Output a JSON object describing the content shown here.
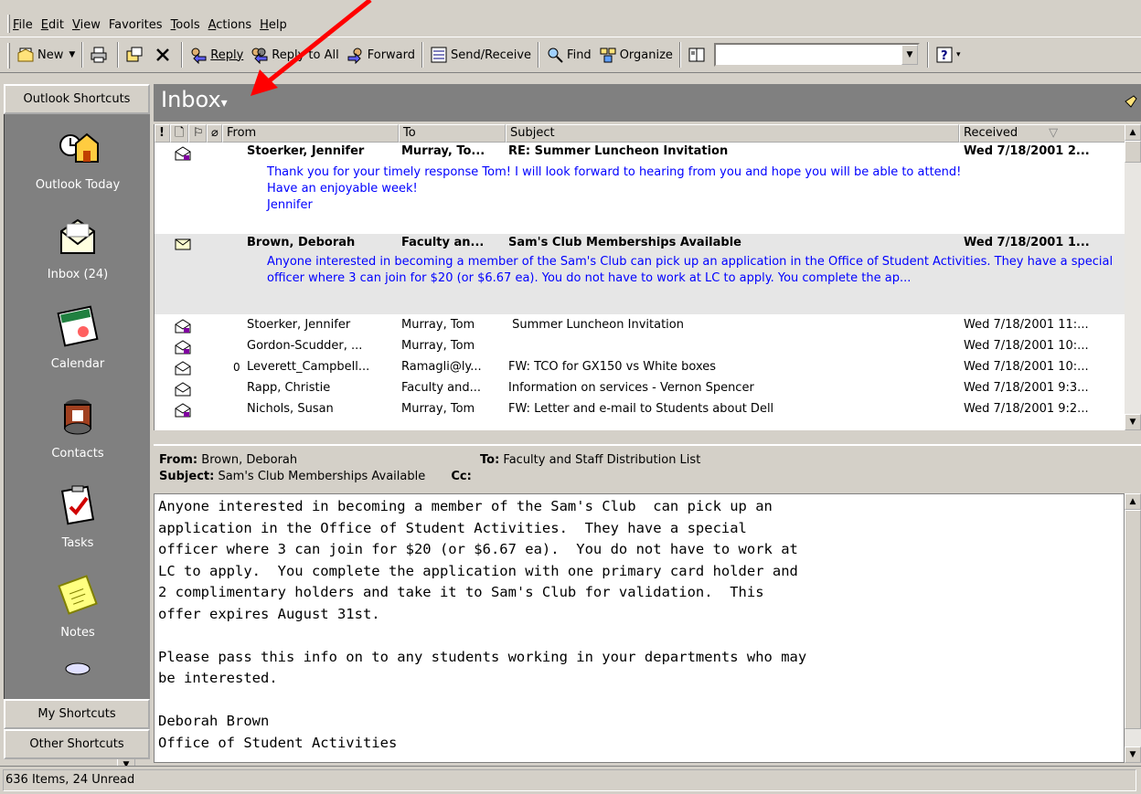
{
  "menubar": {
    "items": [
      {
        "label": "File",
        "u": "F",
        "rest": "ile"
      },
      {
        "label": "Edit",
        "u": "E",
        "rest": "dit"
      },
      {
        "label": "View",
        "u": "V",
        "rest": "iew"
      },
      {
        "label": "Favorites",
        "u": "",
        "rest": "Favorites"
      },
      {
        "label": "Tools",
        "u": "T",
        "rest": "ools"
      },
      {
        "label": "Actions",
        "u": "A",
        "rest": "ctions"
      },
      {
        "label": "Help",
        "u": "H",
        "rest": "elp"
      }
    ]
  },
  "toolbar": {
    "new_label": "New",
    "reply_label": "Reply",
    "reply_all_label": "Reply to All",
    "forward_label": "Forward",
    "send_receive_label": "Send/Receive",
    "find_label": "Find",
    "organize_label": "Organize",
    "search_value": ""
  },
  "outlook_bar": {
    "group_outlook_shortcuts": "Outlook Shortcuts",
    "group_my_shortcuts": "My Shortcuts",
    "group_other_shortcuts": "Other Shortcuts",
    "shortcuts": [
      {
        "label": "Outlook Today",
        "icon": "outlook-today-icon"
      },
      {
        "label": "Inbox (24)",
        "icon": "inbox-icon"
      },
      {
        "label": "Calendar",
        "icon": "calendar-icon"
      },
      {
        "label": "Contacts",
        "icon": "contacts-icon"
      },
      {
        "label": "Tasks",
        "icon": "tasks-icon"
      },
      {
        "label": "Notes",
        "icon": "notes-icon"
      }
    ]
  },
  "banner": {
    "folder_title": "Inbox",
    "caret": "▾"
  },
  "list": {
    "columns": {
      "importance": "!",
      "icon": "",
      "flag": "",
      "attachment": "",
      "from": "From",
      "to": "To",
      "subject": "Subject",
      "received": "Received"
    },
    "messages": [
      {
        "from": "Stoerker, Jennifer",
        "to": "Murray, To...",
        "subject": "RE: Summer Luncheon Invitation",
        "received": "Wed 7/18/2001 2...",
        "unread": true,
        "preview": "Thank you for your timely response Tom!  I will look forward to hearing from you and hope you will be able to attend!\nHave an enjoyable week!\nJennifer"
      },
      {
        "from": "Brown, Deborah",
        "to": "Faculty an...",
        "subject": "Sam's Club Memberships Available",
        "received": "Wed 7/18/2001 1...",
        "unread": true,
        "selected": true,
        "preview": "Anyone interested in becoming a member of the Sam's Club  can pick up an application in the Office of Student Activities.  They have a special officer where 3 can join for $20 (or $6.67 ea).  You do not have to work at LC to apply.  You complete the ap..."
      },
      {
        "from": "Stoerker, Jennifer",
        "to": "Murray, Tom",
        "subject": " Summer Luncheon Invitation",
        "received": "Wed 7/18/2001 11:..."
      },
      {
        "from": "Gordon-Scudder, ...",
        "to": "Murray, Tom",
        "subject": "",
        "received": "Wed 7/18/2001 10:..."
      },
      {
        "from": "Leverett_Campbell...",
        "to": "Ramagli@ly...",
        "subject": "FW: TCO for GX150 vs White boxes",
        "received": "Wed 7/18/2001 10:...",
        "attachment": true
      },
      {
        "from": "Rapp, Christie",
        "to": "Faculty and...",
        "subject": "Information on services - Vernon Spencer",
        "received": "Wed 7/18/2001 9:3..."
      },
      {
        "from": "Nichols, Susan",
        "to": "Murray, Tom",
        "subject": "FW: Letter and e-mail to Students about Dell",
        "received": "Wed 7/18/2001 9:2..."
      }
    ]
  },
  "reading_pane": {
    "from_label": "From:",
    "from_value": "Brown, Deborah",
    "to_label": "To:",
    "to_value": "Faculty and Staff Distribution List",
    "subject_label": "Subject:",
    "subject_value": "Sam's Club Memberships Available",
    "cc_label": "Cc:",
    "body": "Anyone interested in becoming a member of the Sam's Club  can pick up an\napplication in the Office of Student Activities.  They have a special\nofficer where 3 can join for $20 (or $6.67 ea).  You do not have to work at\nLC to apply.  You complete the application with one primary card holder and\n2 complimentary holders and take it to Sam's Club for validation.  This\noffer expires August 31st.\n\nPlease pass this info on to any students working in your departments who may\nbe interested.\n\nDeborah Brown\nOffice of Student Activities"
  },
  "status": {
    "text": "636 Items, 24 Unread"
  },
  "colors": {
    "chrome": "#d4d0c8",
    "banner": "#808080",
    "preview_text": "#0000ff",
    "annotation_arrow": "#ff0000"
  }
}
